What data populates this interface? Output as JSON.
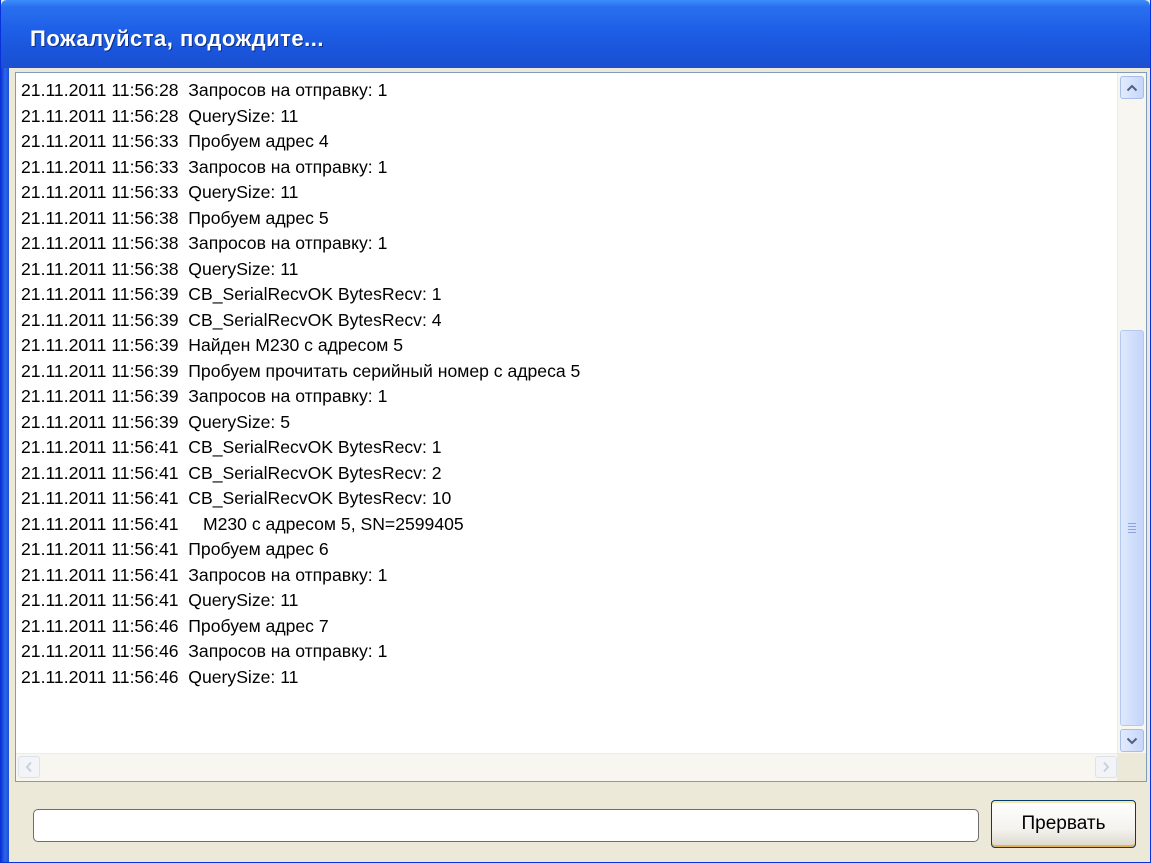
{
  "window": {
    "title": "Пожалуйста, подождите..."
  },
  "log": {
    "lines": [
      "21.11.2011 11:56:28  Запросов на отправку: 1",
      "21.11.2011 11:56:28  QuerySize: 11",
      "21.11.2011 11:56:33  Пробуем адрес 4",
      "21.11.2011 11:56:33  Запросов на отправку: 1",
      "21.11.2011 11:56:33  QuerySize: 11",
      "21.11.2011 11:56:38  Пробуем адрес 5",
      "21.11.2011 11:56:38  Запросов на отправку: 1",
      "21.11.2011 11:56:38  QuerySize: 11",
      "21.11.2011 11:56:39  CB_SerialRecvOK BytesRecv: 1",
      "21.11.2011 11:56:39  CB_SerialRecvOK BytesRecv: 4",
      "21.11.2011 11:56:39  Найден М230 с адресом 5",
      "21.11.2011 11:56:39  Пробуем прочитать серийный номер с адреса 5",
      "21.11.2011 11:56:39  Запросов на отправку: 1",
      "21.11.2011 11:56:39  QuerySize: 5",
      "21.11.2011 11:56:41  CB_SerialRecvOK BytesRecv: 1",
      "21.11.2011 11:56:41  CB_SerialRecvOK BytesRecv: 2",
      "21.11.2011 11:56:41  CB_SerialRecvOK BytesRecv: 10",
      "21.11.2011 11:56:41     М230 с адресом 5, SN=2599405",
      "21.11.2011 11:56:41  Пробуем адрес 6",
      "21.11.2011 11:56:41  Запросов на отправку: 1",
      "21.11.2011 11:56:41  QuerySize: 11",
      "21.11.2011 11:56:46  Пробуем адрес 7",
      "21.11.2011 11:56:46  Запросов на отправку: 1",
      "21.11.2011 11:56:46  QuerySize: 11"
    ]
  },
  "progress": {
    "value": 0
  },
  "buttons": {
    "abort_label": "Прервать"
  },
  "icons": {
    "scroll_up": "chevron-up-icon",
    "scroll_down": "chevron-down-icon",
    "scroll_left": "chevron-left-icon",
    "scroll_right": "chevron-right-icon",
    "thumb_grip": "grip-icon"
  },
  "colors": {
    "titlebar": "#1d5fe6",
    "window_frame": "#0831d9",
    "dialog_background": "#ece9d8",
    "progress_fill": "#3fb83f"
  }
}
